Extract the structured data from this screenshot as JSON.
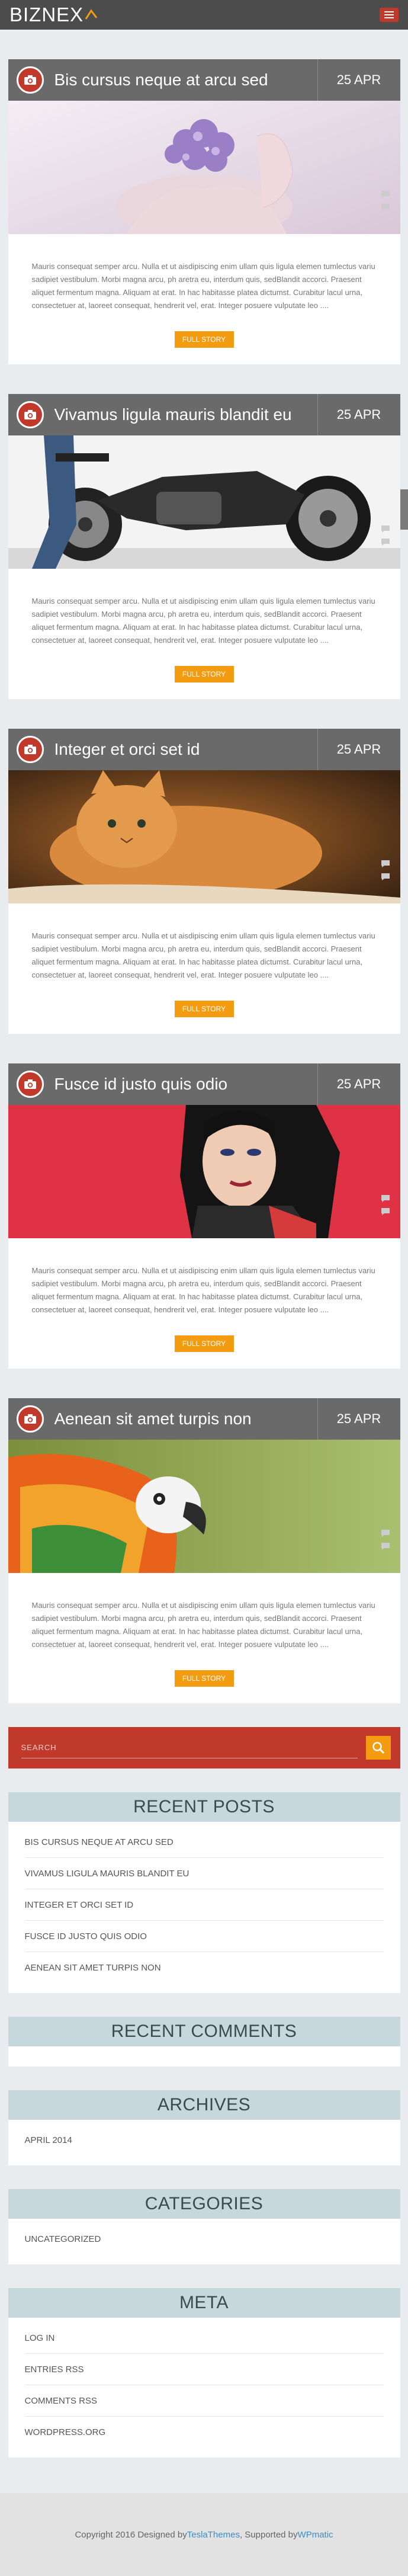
{
  "header": {
    "logo_text": "BIZNEX",
    "menu_icon": "hamburger-icon",
    "accent": "#c0392b"
  },
  "posts": [
    {
      "title": "Bis cursus neque at arcu sed",
      "date": "25 APR",
      "excerpt": "Mauris consequat semper arcu. Nulla et ut aisdipiscing enim ullam quis ligula elemen tumlectus variu sadipiet vestibulum. Morbi magna arcu, ph aretra eu, interdum quis, sedBlandit accorci. Praesent aliquet fermentum magna. Aliquam at erat. In hac habitasse platea dictumst. Curabitur lacul urna, consectetuer at, laoreet consequat, hendrerit vel, erat. Integer posuere vulputate leo ....",
      "read_more": "FULL STORY"
    },
    {
      "title": "Vivamus ligula mauris blandit eu",
      "date": "25 APR",
      "excerpt": "Mauris consequat semper arcu. Nulla et ut aisdipiscing enim ullam quis ligula elemen tumlectus variu sadipiet vestibulum. Morbi magna arcu, ph aretra eu, interdum quis, sedBlandit accorci. Praesent aliquet fermentum magna. Aliquam at erat. In hac habitasse platea dictumst. Curabitur lacul urna, consectetuer at, laoreet consequat, hendrerit vel, erat. Integer posuere vulputate leo ....",
      "read_more": "FULL STORY"
    },
    {
      "title": "Integer et orci set id",
      "date": "25 APR",
      "excerpt": "Mauris consequat semper arcu. Nulla et ut aisdipiscing enim ullam quis ligula elemen tumlectus variu sadipiet vestibulum. Morbi magna arcu, ph aretra eu, interdum quis, sedBlandit accorci. Praesent aliquet fermentum magna. Aliquam at erat. In hac habitasse platea dictumst. Curabitur lacul urna, consectetuer at, laoreet consequat, hendrerit vel, erat. Integer posuere vulputate leo ....",
      "read_more": "FULL STORY"
    },
    {
      "title": "Fusce id justo quis odio",
      "date": "25 APR",
      "excerpt": "Mauris consequat semper arcu. Nulla et ut aisdipiscing enim ullam quis ligula elemen tumlectus variu sadipiet vestibulum. Morbi magna arcu, ph aretra eu, interdum quis, sedBlandit accorci. Praesent aliquet fermentum magna. Aliquam at erat. In hac habitasse platea dictumst. Curabitur lacul urna, consectetuer at, laoreet consequat, hendrerit vel, erat. Integer posuere vulputate leo ....",
      "read_more": "FULL STORY"
    },
    {
      "title": "Aenean sit amet turpis non",
      "date": "25 APR",
      "excerpt": "Mauris consequat semper arcu. Nulla et ut aisdipiscing enim ullam quis ligula elemen tumlectus variu sadipiet vestibulum. Morbi magna arcu, ph aretra eu, interdum quis, sedBlandit accorci. Praesent aliquet fermentum magna. Aliquam at erat. In hac habitasse platea dictumst. Curabitur lacul urna, consectetuer at, laoreet consequat, hendrerit vel, erat. Integer posuere vulputate leo ....",
      "read_more": "FULL STORY"
    }
  ],
  "search": {
    "placeholder": "SEARCH",
    "icon": "search-icon"
  },
  "widgets": {
    "recent_posts": {
      "title": "RECENT POSTS",
      "items": [
        "BIS CURSUS NEQUE AT ARCU SED",
        "VIVAMUS LIGULA MAURIS BLANDIT EU",
        "INTEGER ET ORCI SET ID",
        "FUSCE ID JUSTO QUIS ODIO",
        "AENEAN SIT AMET TURPIS NON"
      ]
    },
    "recent_comments": {
      "title": "RECENT COMMENTS"
    },
    "archives": {
      "title": "ARCHIVES",
      "items": [
        "APRIL 2014"
      ]
    },
    "categories": {
      "title": "CATEGORIES",
      "items": [
        "UNCATEGORIZED"
      ]
    },
    "meta": {
      "title": "META",
      "items": [
        "LOG IN",
        "ENTRIES RSS",
        "COMMENTS RSS",
        "WORDPRESS.ORG"
      ]
    }
  },
  "footer": {
    "prefix": "Copyright 2016 Designed by ",
    "designer": "TeslaThemes",
    "middle": ", Supported by ",
    "supporter": "WPmatic"
  }
}
